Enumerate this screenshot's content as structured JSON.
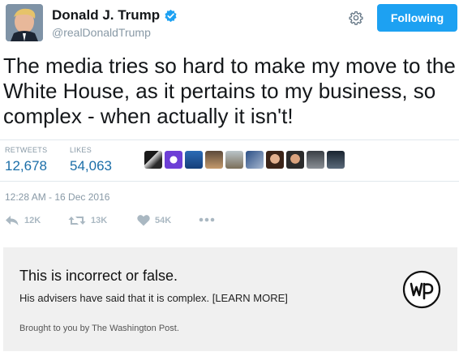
{
  "user": {
    "display_name": "Donald J. Trump",
    "handle": "@realDonaldTrump"
  },
  "follow_button": {
    "label": "Following",
    "color": "#1da1f2"
  },
  "tweet": {
    "text": "The media tries so hard to make my move to the White House, as it pertains to my business, so complex - when actually it isn't!",
    "timestamp": "12:28 AM - 16 Dec 2016"
  },
  "stats": {
    "retweets_label": "RETWEETS",
    "retweets_value": "12,678",
    "likes_label": "LIKES",
    "likes_value": "54,063",
    "value_color": "#1b6ea8"
  },
  "actions": {
    "reply_count": "12K",
    "retweet_count": "13K",
    "like_count": "54K",
    "more_icon": "ellipsis-icon"
  },
  "fact_check": {
    "title": "This is incorrect or false.",
    "description": "His advisers have said that it is complex. [LEARN MORE]",
    "credit": "Brought to you by The Washington Post.",
    "logo_icon": "washington-post-logo"
  },
  "colors": {
    "muted": "#8899a6",
    "action": "#aab8c2",
    "fact_bg": "#f0f0f0"
  }
}
